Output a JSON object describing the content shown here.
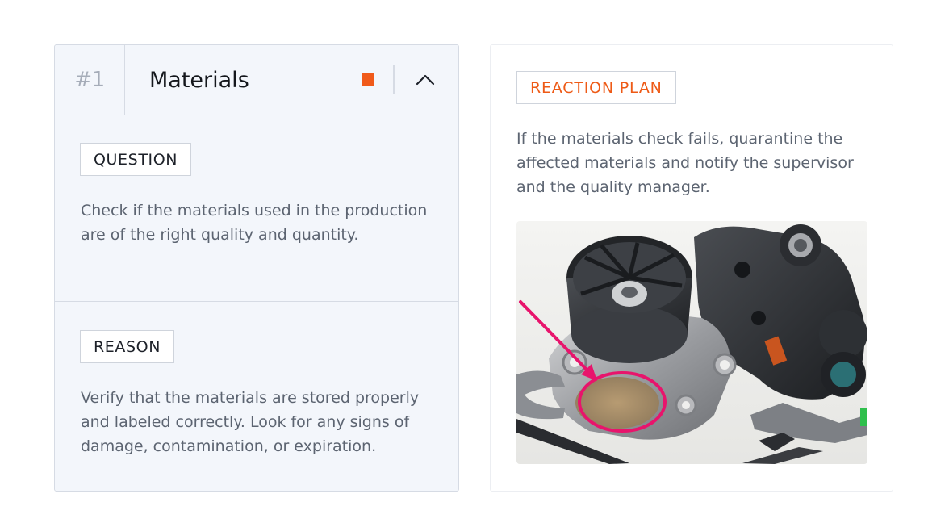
{
  "checklist_item": {
    "number": "#1",
    "title": "Materials",
    "status_color": "#f05a1a",
    "collapse_icon": "chevron-up-icon",
    "question": {
      "tag": "QUESTION",
      "text": "Check if the materials used in the production are of the right quality and quantity."
    },
    "reason": {
      "tag": "REASON",
      "text": "Verify that the materials are stored properly and labeled correctly. Look for any signs of damage, contamination, or expiration."
    }
  },
  "reaction_plan": {
    "tag": "REACTION PLAN",
    "text": "If the materials check fails, quarantine the affected materials and notify the supervisor and the quality manager.",
    "accent_color": "#ee5a16",
    "annotation_color": "#e8146c"
  }
}
